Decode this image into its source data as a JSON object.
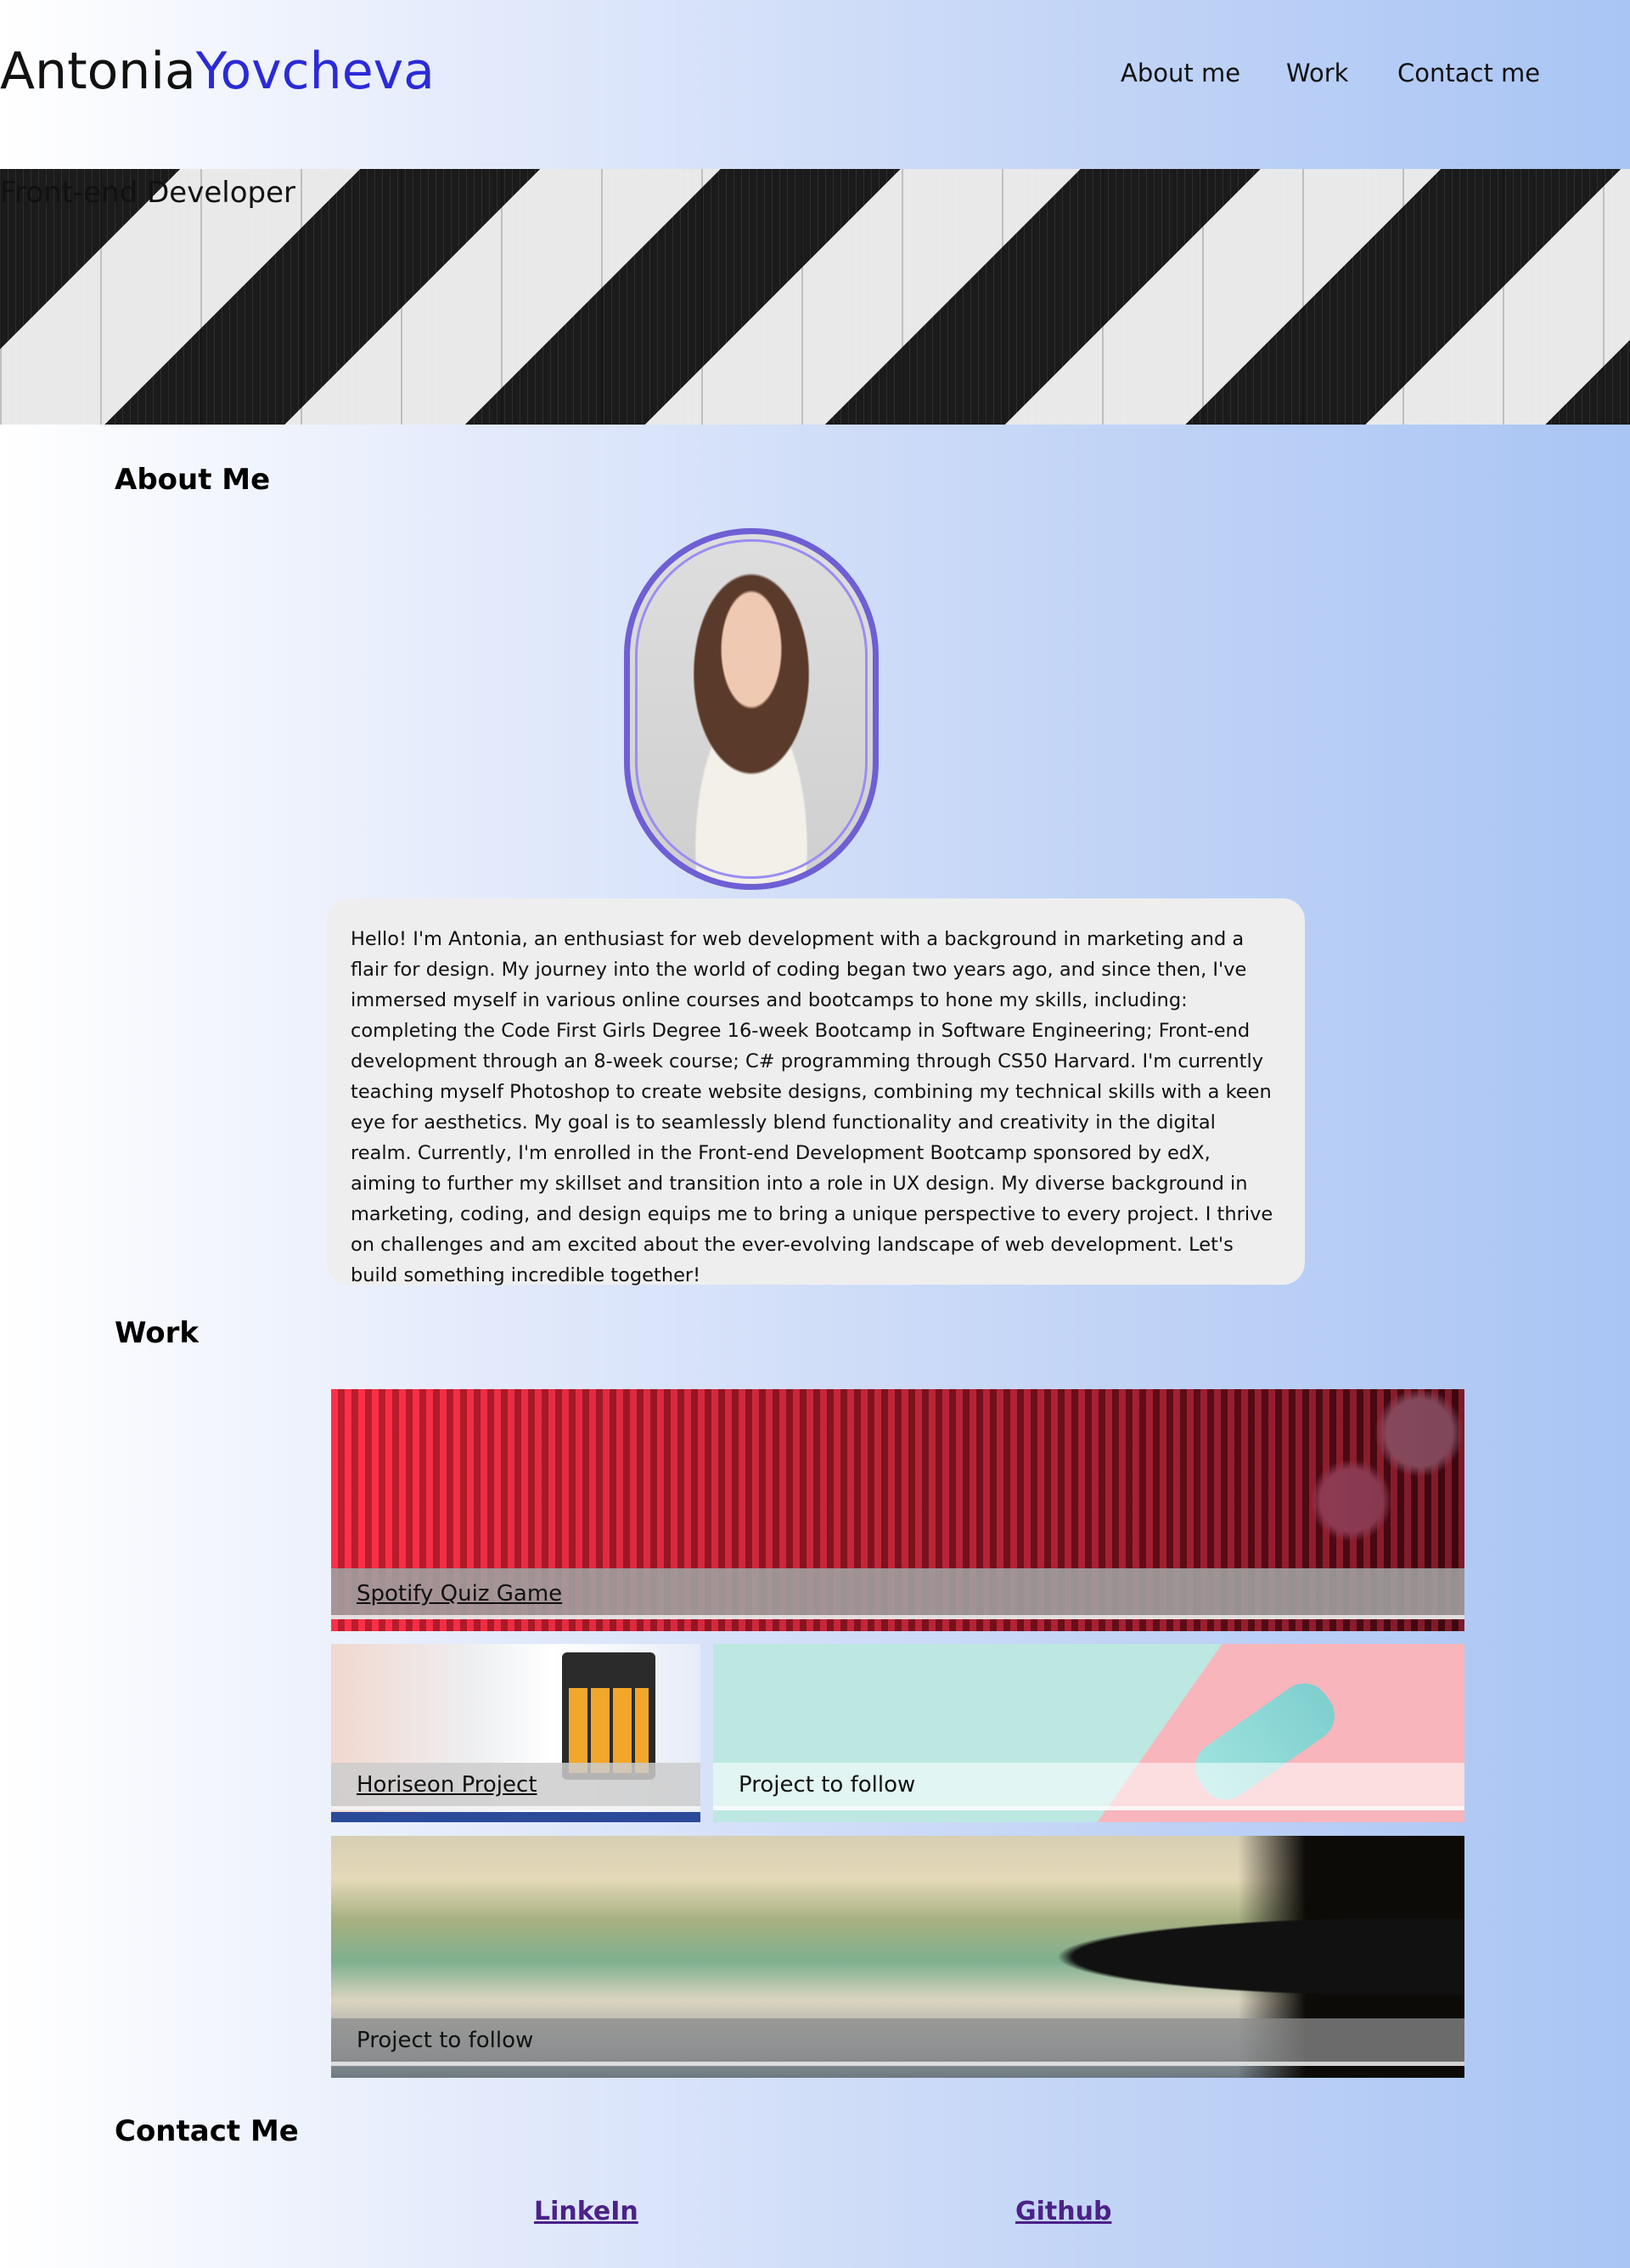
{
  "header": {
    "first_name": "Antonia",
    "last_name": "Yovcheva",
    "nav": [
      "About me",
      "Work",
      "Contact me"
    ]
  },
  "hero": {
    "title": "Front-end Developer"
  },
  "about": {
    "heading": "About Me",
    "text": "Hello! I'm Antonia, an enthusiast for web development with a background in marketing and a flair for design. My journey into the world of coding began two years ago, and since then, I've immersed myself in various online courses and bootcamps to hone my skills, including: completing the Code First Girls Degree 16-week Bootcamp in Software Engineering; Front-end development through an 8-week course; C# programming through CS50 Harvard. I'm currently teaching myself Photoshop to create website designs, combining my technical skills with a keen eye for aesthetics. My goal is to seamlessly blend functionality and creativity in the digital realm. Currently, I'm enrolled in the Front-end Development Bootcamp sponsored by edX, aiming to further my skillset and transition into a role in UX design. My diverse background in marketing, coding, and design equips me to bring a unique perspective to every project. I thrive on challenges and am excited about the ever-evolving landscape of web development. Let's build something incredible together!"
  },
  "work": {
    "heading": "Work",
    "projects": [
      "Spotify Quiz Game",
      "Horiseon Project",
      "Project to follow",
      "Project to follow"
    ]
  },
  "contact": {
    "heading": "Contact Me",
    "links": [
      "LinkeIn",
      "Github"
    ]
  },
  "colors": {
    "accent": "#2a2ad8",
    "portrait_border": "#6e5fd4",
    "link": "#4b2288"
  }
}
